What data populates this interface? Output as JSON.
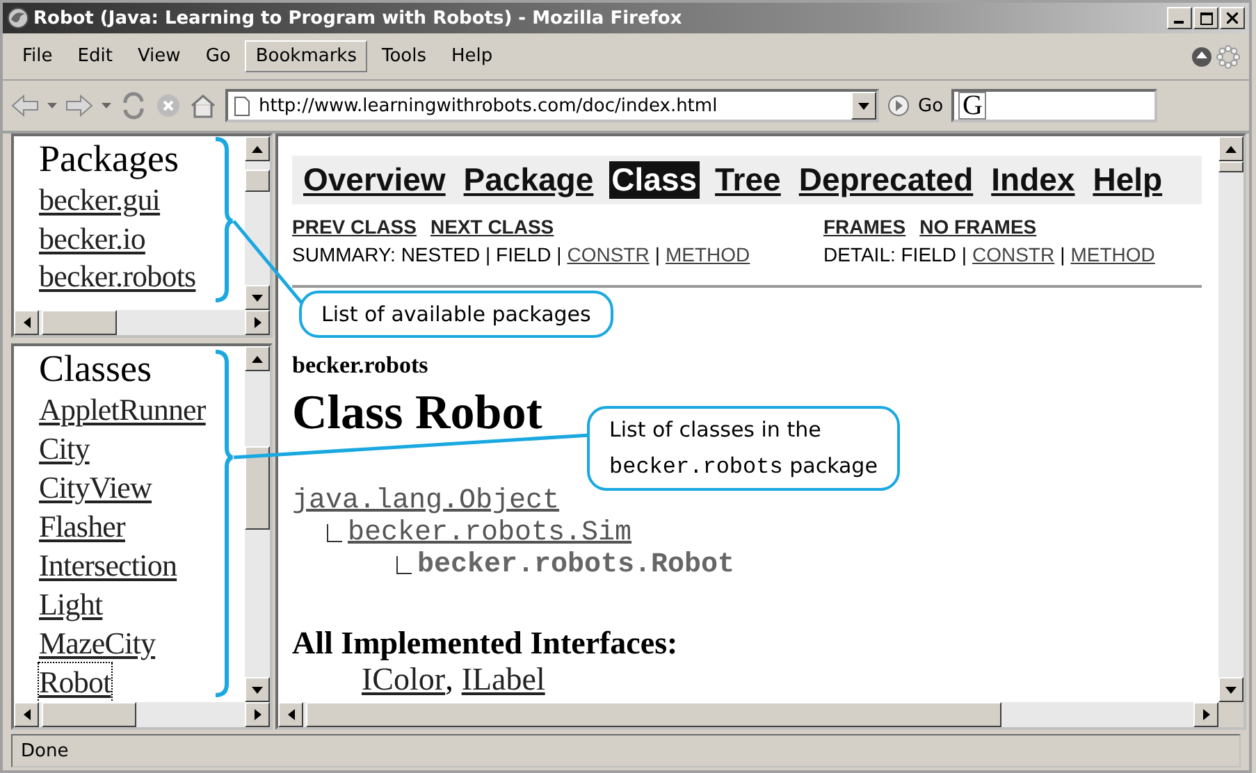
{
  "window": {
    "title": "Robot (Java: Learning to Program with Robots) - Mozilla Firefox"
  },
  "menu": [
    {
      "label": "File",
      "selected": false
    },
    {
      "label": "Edit",
      "selected": false
    },
    {
      "label": "View",
      "selected": false
    },
    {
      "label": "Go",
      "selected": false
    },
    {
      "label": "Bookmarks",
      "selected": true
    },
    {
      "label": "Tools",
      "selected": false
    },
    {
      "label": "Help",
      "selected": false
    }
  ],
  "toolbar": {
    "address": "http://www.learningwithrobots.com/doc/index.html",
    "go_label": "Go",
    "search_logo": "G"
  },
  "packages_frame": {
    "heading": "Packages",
    "items": [
      "becker.gui",
      "becker.io",
      "becker.robots"
    ]
  },
  "classes_frame": {
    "heading": "Classes",
    "items": [
      {
        "label": "AppletRunner",
        "selected": false
      },
      {
        "label": "City",
        "selected": false
      },
      {
        "label": "CityView",
        "selected": false
      },
      {
        "label": "Flasher",
        "selected": false
      },
      {
        "label": "Intersection",
        "selected": false
      },
      {
        "label": "Light",
        "selected": false
      },
      {
        "label": "MazeCity",
        "selected": false
      },
      {
        "label": "Robot",
        "selected": true
      }
    ]
  },
  "doc": {
    "nav": [
      {
        "label": "Overview",
        "selected": false
      },
      {
        "label": "Package",
        "selected": false
      },
      {
        "label": "Class",
        "selected": true
      },
      {
        "label": "Tree",
        "selected": false
      },
      {
        "label": "Deprecated",
        "selected": false
      },
      {
        "label": "Index",
        "selected": false
      },
      {
        "label": "Help",
        "selected": false
      }
    ],
    "subnav_left": [
      "PREV CLASS",
      "NEXT CLASS"
    ],
    "subnav_right": [
      "FRAMES",
      "NO FRAMES"
    ],
    "summary": [
      {
        "text": "SUMMARY: NESTED | FIELD |",
        "kind": "text"
      },
      {
        "text": "CONSTR",
        "kind": "link"
      },
      {
        "text": "|",
        "kind": "text"
      },
      {
        "text": "METHOD",
        "kind": "link"
      }
    ],
    "detail": [
      {
        "text": "DETAIL: FIELD |",
        "kind": "text"
      },
      {
        "text": "CONSTR",
        "kind": "link"
      },
      {
        "text": "|",
        "kind": "text"
      },
      {
        "text": "METHOD",
        "kind": "link"
      }
    ],
    "package": "becker.robots",
    "title": "Class Robot",
    "hierarchy": {
      "label": "java.lang.Object",
      "link": true,
      "children": [
        {
          "label": "becker.robots.Sim",
          "link": true,
          "children": [
            {
              "label": "becker.robots.Robot",
              "link": false
            }
          ]
        }
      ]
    },
    "interfaces_heading": "All Implemented Interfaces:",
    "interfaces": [
      {
        "text": "IColor",
        "kind": "link"
      },
      {
        "text": ",",
        "kind": "text"
      },
      {
        "text": "ILabel",
        "kind": "link"
      }
    ]
  },
  "callouts": [
    {
      "lines": [
        [
          {
            "text": "List of available packages",
            "kind": "text"
          }
        ]
      ]
    },
    {
      "lines": [
        [
          {
            "text": "List of classes in the",
            "kind": "text"
          }
        ],
        [
          {
            "text": "becker.robots",
            "kind": "code"
          },
          {
            "text": "package",
            "kind": "text"
          }
        ]
      ]
    }
  ],
  "status_bar": "Done"
}
